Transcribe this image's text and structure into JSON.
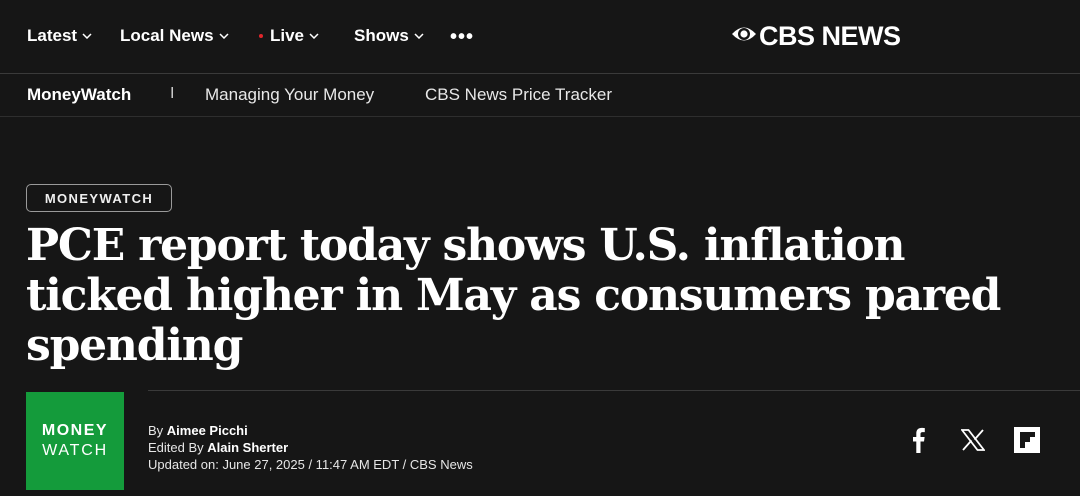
{
  "topnav": {
    "items": [
      {
        "label": "Latest",
        "has_dropdown": true
      },
      {
        "label": "Local News",
        "has_dropdown": true
      },
      {
        "label": "Live",
        "has_dropdown": true,
        "indicator": "live-dot"
      },
      {
        "label": "Shows",
        "has_dropdown": true
      }
    ],
    "more_label": "•••",
    "logo_text": "CBS NEWS",
    "logo_icon": "cbs-eye-icon"
  },
  "subnav": {
    "brand": "MoneyWatch",
    "separator": "I",
    "links": [
      "Managing Your Money",
      "CBS News Price Tracker"
    ]
  },
  "article": {
    "category_badge": "MONEYWATCH",
    "headline": "PCE report today shows U.S. inflation ticked higher in May as consumers pared spending",
    "logo": {
      "line1": "MONEY",
      "line2": "WATCH",
      "color": "#149b3b"
    },
    "byline_prefix": "By ",
    "author": "Aimee Picchi",
    "edited_prefix": "Edited By ",
    "editor": "Alain Sherter",
    "updated": "Updated on: June 27, 2025 / 11:47 AM EDT / CBS News"
  },
  "share": [
    "facebook-icon",
    "x-icon",
    "flipboard-icon"
  ],
  "colors": {
    "background": "#161616",
    "live_dot": "#e0262b",
    "accent_green": "#149b3b"
  }
}
